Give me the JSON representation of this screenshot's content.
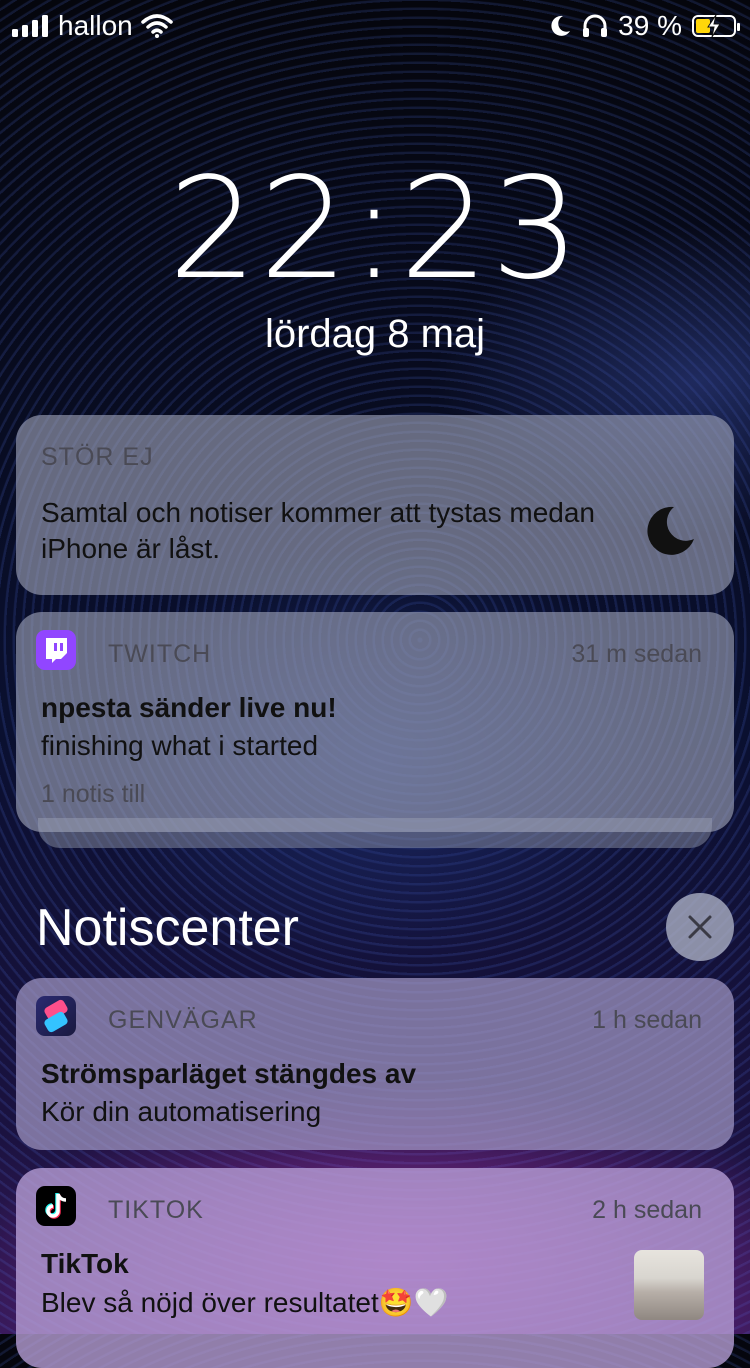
{
  "status": {
    "carrier": "hallon",
    "battery_percent": "39 %",
    "battery_level": 0.39,
    "icons": [
      "signal-icon",
      "wifi-icon",
      "moon-icon",
      "headphones-icon",
      "battery-charging-icon"
    ]
  },
  "lock": {
    "time": "22:23",
    "date": "lördag 8 maj"
  },
  "dnd": {
    "label": "STÖR EJ",
    "text": "Samtal och notiser kommer att tystas medan iPhone är låst."
  },
  "twitch": {
    "app": "TWITCH",
    "time": "31 m sedan",
    "title": "npesta sänder live nu!",
    "body": "finishing what i started",
    "more": "1 notis till",
    "accent": "#9146ff"
  },
  "center": {
    "title": "Notiscenter"
  },
  "shortcuts": {
    "app": "GENVÄGAR",
    "time": "1 h sedan",
    "title": "Strömsparläget stängdes av",
    "body": "Kör din automatisering"
  },
  "tiktok": {
    "app": "TIKTOK",
    "time": "2 h sedan",
    "title": "TikTok",
    "body": "Blev så nöjd över resultatet🤩🤍"
  }
}
